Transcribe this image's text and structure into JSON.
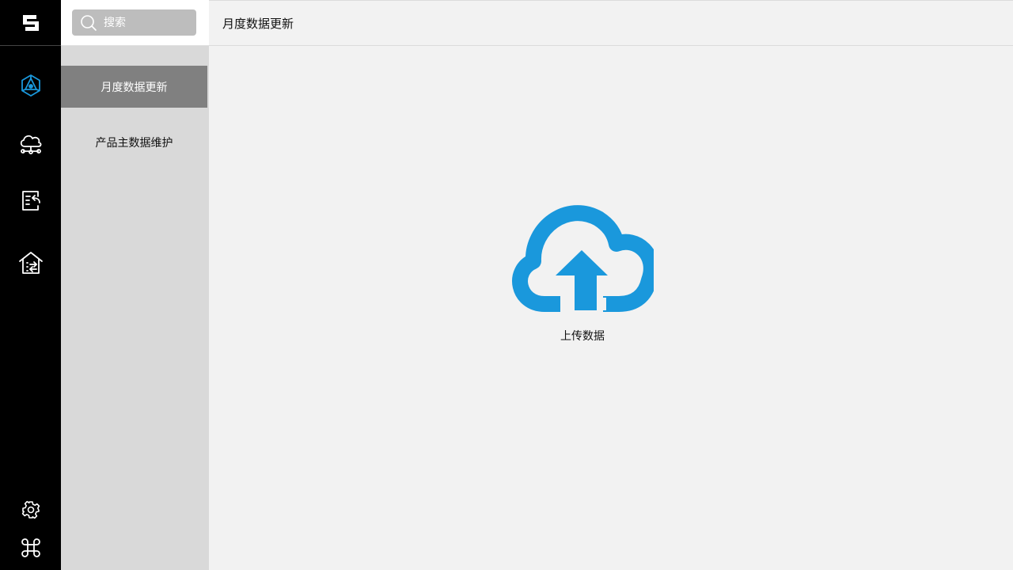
{
  "search": {
    "placeholder": "搜索"
  },
  "sidebar": {
    "items": [
      {
        "label": "月度数据更新",
        "active": true
      },
      {
        "label": "产品主数据维护",
        "active": false
      }
    ]
  },
  "header": {
    "title": "月度数据更新"
  },
  "main": {
    "upload_label": "上传数据"
  },
  "rail": {
    "icons": [
      "logo-icon",
      "network-icon",
      "cloud-network-icon",
      "document-return-icon",
      "home-transfer-icon",
      "gear-icon",
      "command-icon"
    ]
  },
  "colors": {
    "accent": "#1a98dc",
    "rail_bg": "#000000",
    "sidebar_bg": "#d9d9d9",
    "active_item_bg": "#808080",
    "main_bg": "#f2f2f2"
  }
}
